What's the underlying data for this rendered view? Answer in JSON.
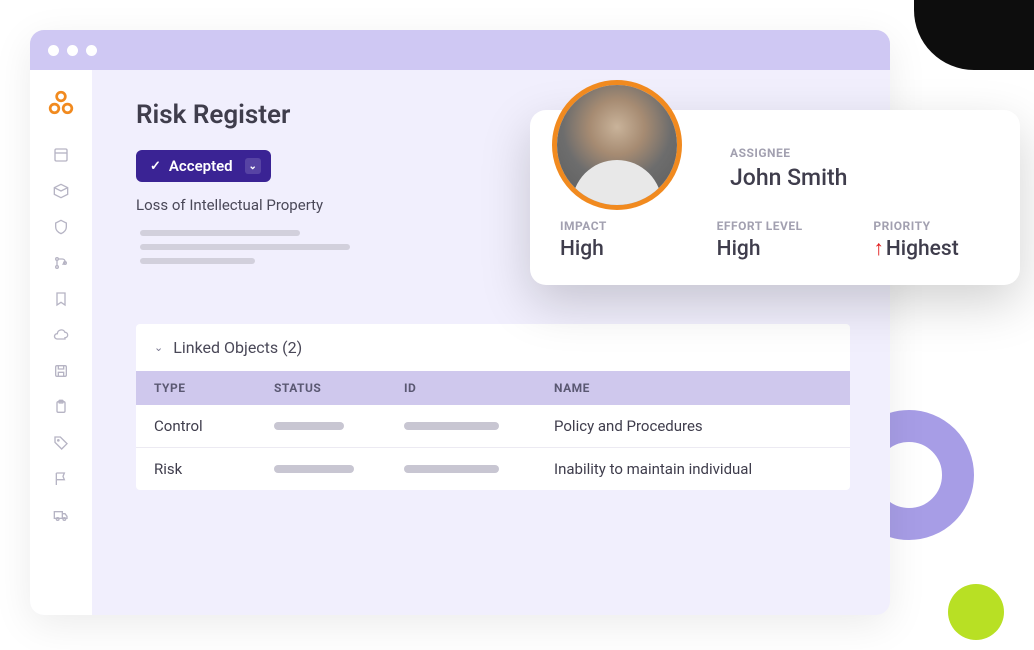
{
  "page": {
    "title": "Risk Register",
    "status_label": "Accepted",
    "risk_name": "Loss of Intellectual Property"
  },
  "linked": {
    "title": "Linked Objects (2)",
    "columns": {
      "type": "TYPE",
      "status": "STATUS",
      "id": "ID",
      "name": "NAME"
    },
    "rows": [
      {
        "type": "Control",
        "name": "Policy and Procedures"
      },
      {
        "type": "Risk",
        "name": "Inability to maintain individual"
      }
    ]
  },
  "card": {
    "assignee_label": "ASSIGNEE",
    "assignee_name": "John Smith",
    "impact_label": "IMPACT",
    "impact_value": "High",
    "effort_label": "EFFORT LEVEL",
    "effort_value": "High",
    "priority_label": "PRIORITY",
    "priority_value": "Highest",
    "priority_arrow": "↑"
  },
  "colors": {
    "accent_purple": "#3a2394",
    "orange": "#f18a1f",
    "lavender": "#cfc8f3"
  }
}
